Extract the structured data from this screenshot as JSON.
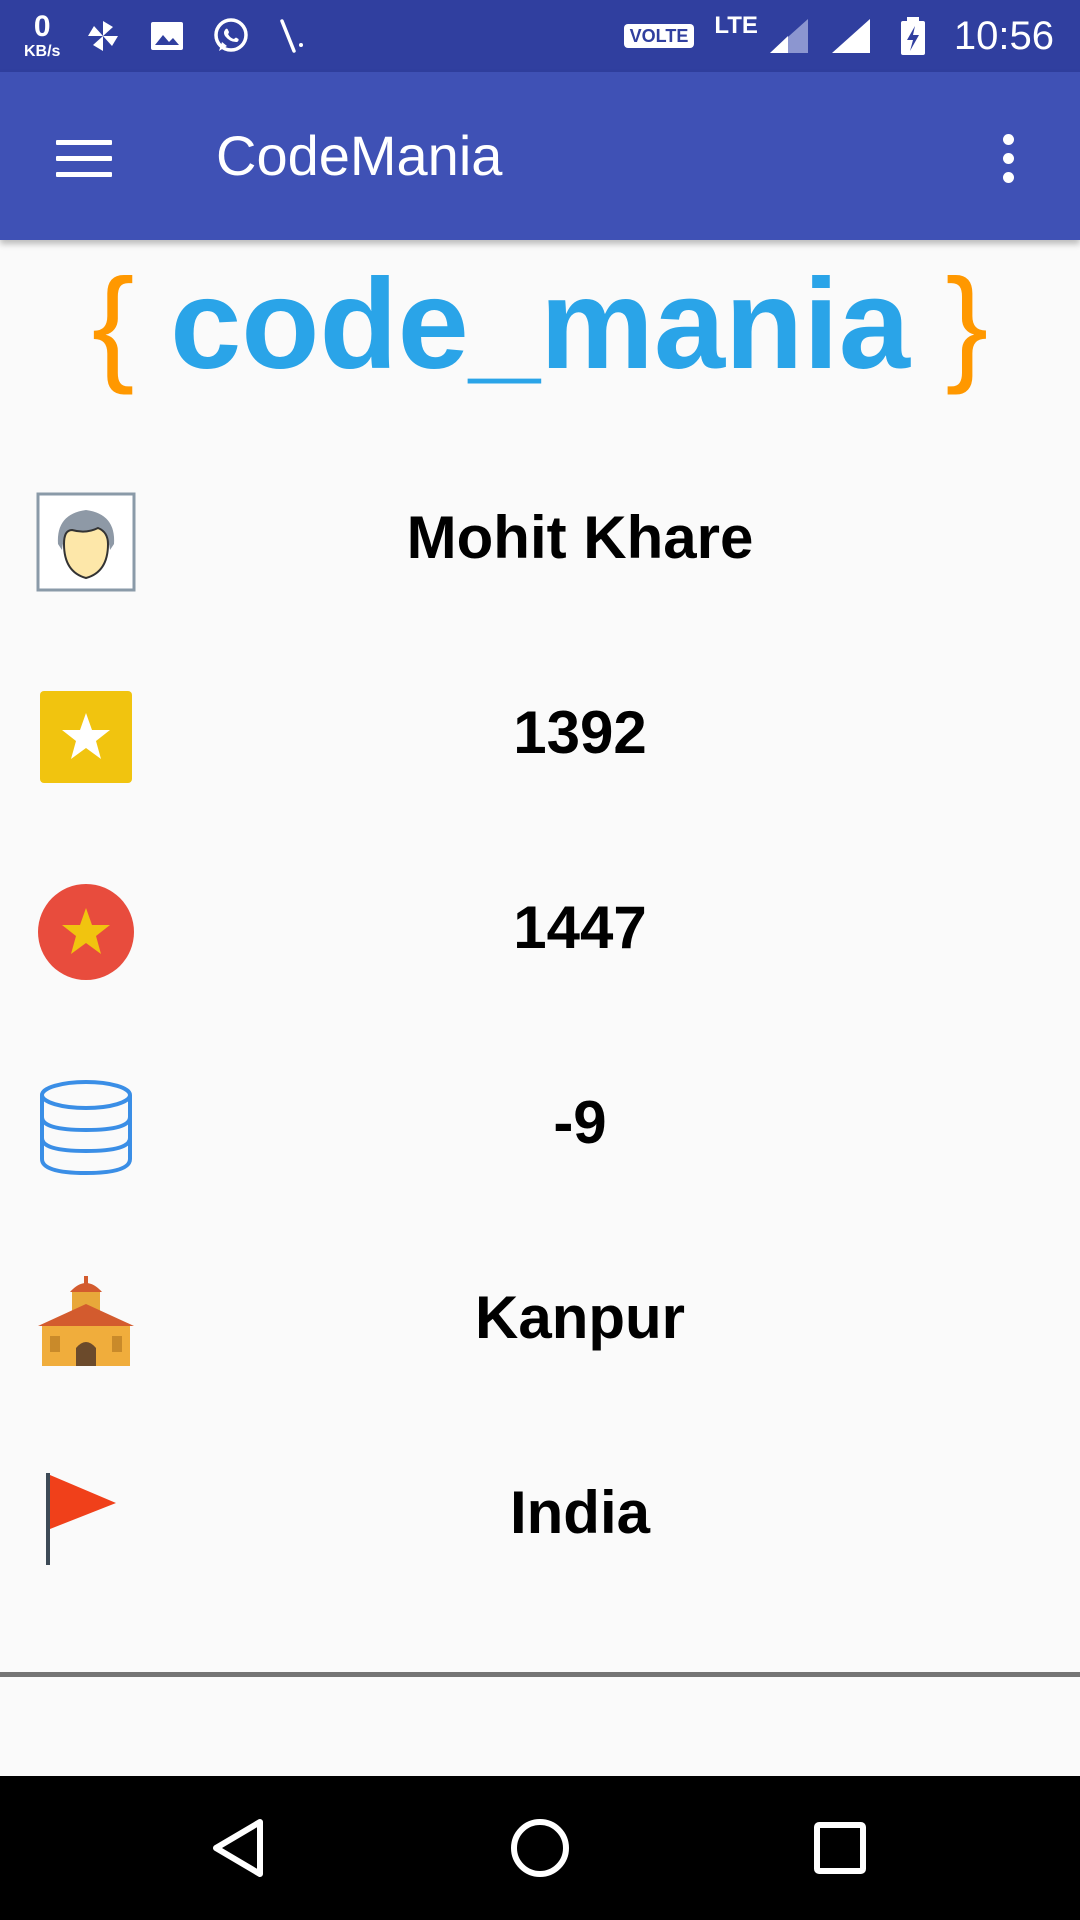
{
  "status_bar": {
    "kb_value": "0",
    "kb_unit": "KB/s",
    "volte": "VOLTE",
    "network": "LTE",
    "time": "10:56",
    "icons": [
      "pinwheel-icon",
      "image-icon",
      "whatsapp-icon",
      "missed-call-icon",
      "signal-icon",
      "battery-charging-icon"
    ]
  },
  "app_bar": {
    "title": "CodeMania"
  },
  "logo": {
    "open_brace": "{",
    "text": "code_mania",
    "close_brace": "}"
  },
  "profile": {
    "rows": [
      {
        "icon": "user-avatar-icon",
        "value": "Mohit Khare"
      },
      {
        "icon": "yellow-star-icon",
        "value": "1392"
      },
      {
        "icon": "red-star-badge-icon",
        "value": "1447"
      },
      {
        "icon": "database-icon",
        "value": "-9"
      },
      {
        "icon": "building-icon",
        "value": "Kanpur"
      },
      {
        "icon": "flag-icon",
        "value": "India"
      }
    ]
  },
  "colors": {
    "status_bar": "#303f9f",
    "app_bar": "#3f51b5",
    "logo_brace": "#ff9800",
    "logo_text": "#2aa4e8"
  }
}
